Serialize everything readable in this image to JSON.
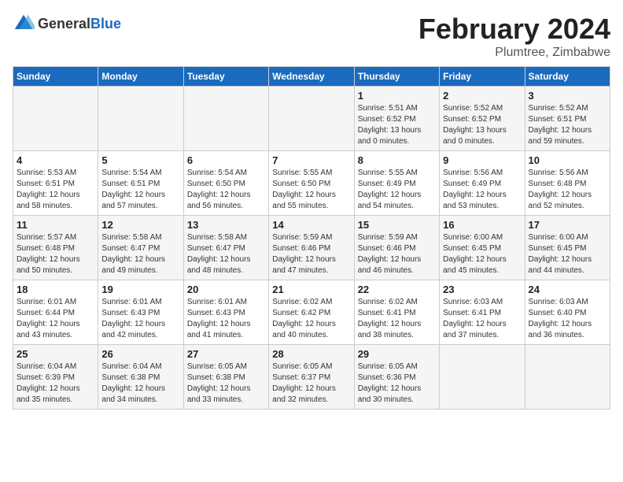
{
  "logo": {
    "text_general": "General",
    "text_blue": "Blue"
  },
  "header": {
    "month": "February 2024",
    "location": "Plumtree, Zimbabwe"
  },
  "weekdays": [
    "Sunday",
    "Monday",
    "Tuesday",
    "Wednesday",
    "Thursday",
    "Friday",
    "Saturday"
  ],
  "weeks": [
    [
      {
        "day": "",
        "info": ""
      },
      {
        "day": "",
        "info": ""
      },
      {
        "day": "",
        "info": ""
      },
      {
        "day": "",
        "info": ""
      },
      {
        "day": "1",
        "info": "Sunrise: 5:51 AM\nSunset: 6:52 PM\nDaylight: 13 hours\nand 0 minutes."
      },
      {
        "day": "2",
        "info": "Sunrise: 5:52 AM\nSunset: 6:52 PM\nDaylight: 13 hours\nand 0 minutes."
      },
      {
        "day": "3",
        "info": "Sunrise: 5:52 AM\nSunset: 6:51 PM\nDaylight: 12 hours\nand 59 minutes."
      }
    ],
    [
      {
        "day": "4",
        "info": "Sunrise: 5:53 AM\nSunset: 6:51 PM\nDaylight: 12 hours\nand 58 minutes."
      },
      {
        "day": "5",
        "info": "Sunrise: 5:54 AM\nSunset: 6:51 PM\nDaylight: 12 hours\nand 57 minutes."
      },
      {
        "day": "6",
        "info": "Sunrise: 5:54 AM\nSunset: 6:50 PM\nDaylight: 12 hours\nand 56 minutes."
      },
      {
        "day": "7",
        "info": "Sunrise: 5:55 AM\nSunset: 6:50 PM\nDaylight: 12 hours\nand 55 minutes."
      },
      {
        "day": "8",
        "info": "Sunrise: 5:55 AM\nSunset: 6:49 PM\nDaylight: 12 hours\nand 54 minutes."
      },
      {
        "day": "9",
        "info": "Sunrise: 5:56 AM\nSunset: 6:49 PM\nDaylight: 12 hours\nand 53 minutes."
      },
      {
        "day": "10",
        "info": "Sunrise: 5:56 AM\nSunset: 6:48 PM\nDaylight: 12 hours\nand 52 minutes."
      }
    ],
    [
      {
        "day": "11",
        "info": "Sunrise: 5:57 AM\nSunset: 6:48 PM\nDaylight: 12 hours\nand 50 minutes."
      },
      {
        "day": "12",
        "info": "Sunrise: 5:58 AM\nSunset: 6:47 PM\nDaylight: 12 hours\nand 49 minutes."
      },
      {
        "day": "13",
        "info": "Sunrise: 5:58 AM\nSunset: 6:47 PM\nDaylight: 12 hours\nand 48 minutes."
      },
      {
        "day": "14",
        "info": "Sunrise: 5:59 AM\nSunset: 6:46 PM\nDaylight: 12 hours\nand 47 minutes."
      },
      {
        "day": "15",
        "info": "Sunrise: 5:59 AM\nSunset: 6:46 PM\nDaylight: 12 hours\nand 46 minutes."
      },
      {
        "day": "16",
        "info": "Sunrise: 6:00 AM\nSunset: 6:45 PM\nDaylight: 12 hours\nand 45 minutes."
      },
      {
        "day": "17",
        "info": "Sunrise: 6:00 AM\nSunset: 6:45 PM\nDaylight: 12 hours\nand 44 minutes."
      }
    ],
    [
      {
        "day": "18",
        "info": "Sunrise: 6:01 AM\nSunset: 6:44 PM\nDaylight: 12 hours\nand 43 minutes."
      },
      {
        "day": "19",
        "info": "Sunrise: 6:01 AM\nSunset: 6:43 PM\nDaylight: 12 hours\nand 42 minutes."
      },
      {
        "day": "20",
        "info": "Sunrise: 6:01 AM\nSunset: 6:43 PM\nDaylight: 12 hours\nand 41 minutes."
      },
      {
        "day": "21",
        "info": "Sunrise: 6:02 AM\nSunset: 6:42 PM\nDaylight: 12 hours\nand 40 minutes."
      },
      {
        "day": "22",
        "info": "Sunrise: 6:02 AM\nSunset: 6:41 PM\nDaylight: 12 hours\nand 38 minutes."
      },
      {
        "day": "23",
        "info": "Sunrise: 6:03 AM\nSunset: 6:41 PM\nDaylight: 12 hours\nand 37 minutes."
      },
      {
        "day": "24",
        "info": "Sunrise: 6:03 AM\nSunset: 6:40 PM\nDaylight: 12 hours\nand 36 minutes."
      }
    ],
    [
      {
        "day": "25",
        "info": "Sunrise: 6:04 AM\nSunset: 6:39 PM\nDaylight: 12 hours\nand 35 minutes."
      },
      {
        "day": "26",
        "info": "Sunrise: 6:04 AM\nSunset: 6:38 PM\nDaylight: 12 hours\nand 34 minutes."
      },
      {
        "day": "27",
        "info": "Sunrise: 6:05 AM\nSunset: 6:38 PM\nDaylight: 12 hours\nand 33 minutes."
      },
      {
        "day": "28",
        "info": "Sunrise: 6:05 AM\nSunset: 6:37 PM\nDaylight: 12 hours\nand 32 minutes."
      },
      {
        "day": "29",
        "info": "Sunrise: 6:05 AM\nSunset: 6:36 PM\nDaylight: 12 hours\nand 30 minutes."
      },
      {
        "day": "",
        "info": ""
      },
      {
        "day": "",
        "info": ""
      }
    ]
  ]
}
